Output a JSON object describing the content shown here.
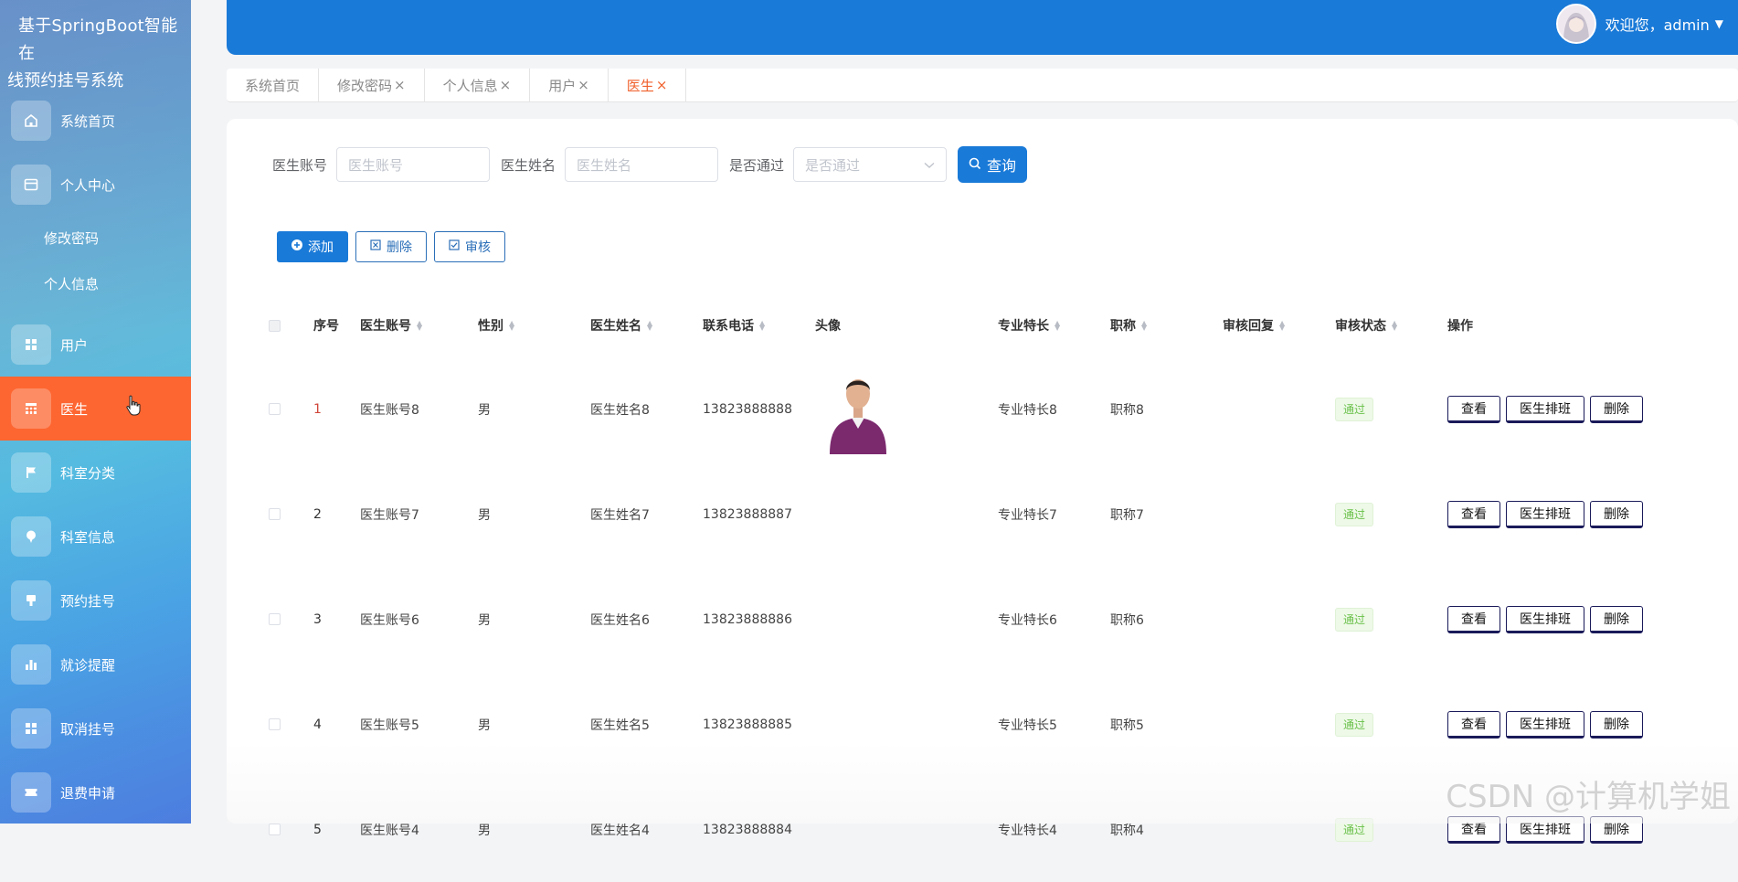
{
  "app": {
    "title_line1": "基于SpringBoot智能在",
    "title_line2": "线预约挂号系统"
  },
  "sidebar": {
    "items": [
      {
        "label": "系统首页",
        "icon": "home-icon"
      },
      {
        "label": "个人中心",
        "icon": "profile-card-icon"
      },
      {
        "label": "用户",
        "icon": "grid-icon"
      },
      {
        "label": "医生",
        "icon": "table-icon"
      },
      {
        "label": "科室分类",
        "icon": "flag-icon"
      },
      {
        "label": "科室信息",
        "icon": "pin-icon"
      },
      {
        "label": "预约挂号",
        "icon": "stamp-icon"
      },
      {
        "label": "就诊提醒",
        "icon": "bar-chart-icon"
      },
      {
        "label": "取消挂号",
        "icon": "grid-icon"
      },
      {
        "label": "退费申请",
        "icon": "ticket-icon"
      }
    ],
    "sub_items": [
      "修改密码",
      "个人信息"
    ],
    "active_item": "医生",
    "active_color": "#fd6631"
  },
  "header": {
    "greeting": "欢迎您，admin",
    "bar_color": "#1a7ad8"
  },
  "tabs": [
    {
      "label": "系统首页",
      "closable": false
    },
    {
      "label": "修改密码",
      "closable": true
    },
    {
      "label": "个人信息",
      "closable": true
    },
    {
      "label": "用户",
      "closable": true
    },
    {
      "label": "医生",
      "closable": true,
      "active": true
    }
  ],
  "tab_close_glyph": "×",
  "search": {
    "account_label": "医生账号",
    "account_placeholder": "医生账号",
    "name_label": "医生姓名",
    "name_placeholder": "医生姓名",
    "passed_label": "是否通过",
    "passed_placeholder": "是否通过",
    "query_button": "查询"
  },
  "toolbar": {
    "add": "添加",
    "delete": "删除",
    "audit": "审核"
  },
  "table": {
    "columns": [
      "序号",
      "医生账号",
      "性别",
      "医生姓名",
      "联系电话",
      "头像",
      "专业特长",
      "职称",
      "审核回复",
      "审核状态",
      "操作"
    ],
    "rows": [
      {
        "index": "1",
        "account": "医生账号8",
        "gender": "男",
        "name": "医生姓名8",
        "phone": "13823888888",
        "has_photo": true,
        "specialty": "专业特长8",
        "title": "职称8",
        "reply": "",
        "status": "通过"
      },
      {
        "index": "2",
        "account": "医生账号7",
        "gender": "男",
        "name": "医生姓名7",
        "phone": "13823888887",
        "has_photo": false,
        "specialty": "专业特长7",
        "title": "职称7",
        "reply": "",
        "status": "通过"
      },
      {
        "index": "3",
        "account": "医生账号6",
        "gender": "男",
        "name": "医生姓名6",
        "phone": "13823888886",
        "has_photo": false,
        "specialty": "专业特长6",
        "title": "职称6",
        "reply": "",
        "status": "通过"
      },
      {
        "index": "4",
        "account": "医生账号5",
        "gender": "男",
        "name": "医生姓名5",
        "phone": "13823888885",
        "has_photo": false,
        "specialty": "专业特长5",
        "title": "职称5",
        "reply": "",
        "status": "通过"
      },
      {
        "index": "5",
        "account": "医生账号4",
        "gender": "男",
        "name": "医生姓名4",
        "phone": "13823888884",
        "has_photo": false,
        "specialty": "专业特长4",
        "title": "职称4",
        "reply": "",
        "status": "通过"
      }
    ],
    "row_actions": [
      "查看",
      "医生排班",
      "删除"
    ]
  },
  "watermark": "CSDN @计算机学姐"
}
